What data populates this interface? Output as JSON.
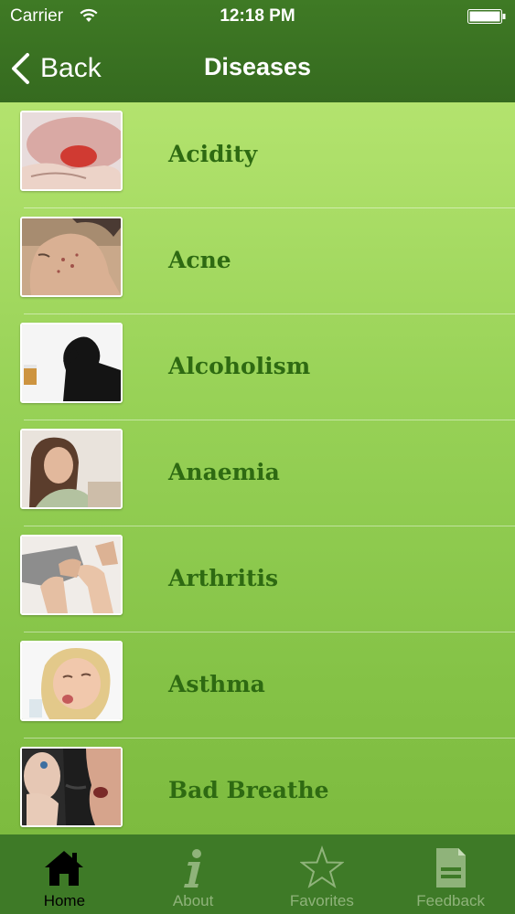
{
  "status_bar": {
    "carrier": "Carrier",
    "time": "12:18 PM",
    "icons": [
      "wifi-icon",
      "battery-icon"
    ]
  },
  "nav": {
    "back_label": "Back",
    "back_icon": "chevron-left-icon",
    "title": "Diseases"
  },
  "diseases": [
    {
      "label": "Acidity",
      "thumbnail": "stomach-pain-photo"
    },
    {
      "label": "Acne",
      "thumbnail": "acne-face-photo"
    },
    {
      "label": "Alcoholism",
      "thumbnail": "man-with-drink-silhouette-photo"
    },
    {
      "label": "Anaemia",
      "thumbnail": "tired-woman-photo"
    },
    {
      "label": "Arthritis",
      "thumbnail": "knee-pain-photo"
    },
    {
      "label": "Asthma",
      "thumbnail": "child-coughing-photo"
    },
    {
      "label": "Bad Breathe",
      "thumbnail": "bad-breath-photo"
    }
  ],
  "tab_bar": {
    "active": "Home",
    "tabs": [
      {
        "label": "Home",
        "icon": "home-icon"
      },
      {
        "label": "About",
        "icon": "info-icon"
      },
      {
        "label": "Favorites",
        "icon": "star-icon"
      },
      {
        "label": "Feedback",
        "icon": "feedback-document-icon"
      }
    ]
  },
  "colors": {
    "header_bg": "#3f7a25",
    "list_gradient_top": "#b3e36e",
    "list_gradient_bottom": "#7dbb3f",
    "item_text": "#2e6a12",
    "tab_bar_bg": "#3e7a27",
    "tab_inactive": "#8fb37a",
    "tab_active": "#000000"
  }
}
